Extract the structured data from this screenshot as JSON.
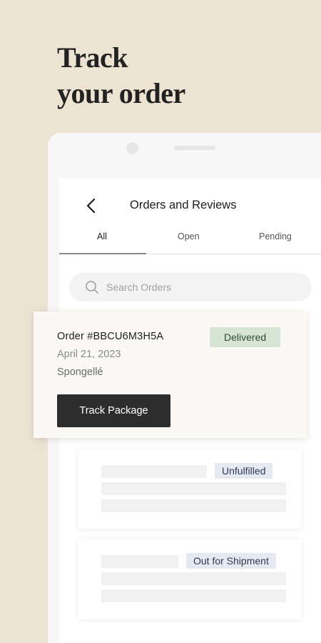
{
  "hero": {
    "line1": "Track",
    "line2": "your order"
  },
  "header": {
    "title": "Orders and Reviews",
    "back_icon": "chevron-left-icon"
  },
  "tabs": [
    {
      "label": "All",
      "active": true
    },
    {
      "label": "Open",
      "active": false
    },
    {
      "label": "Pending",
      "active": false
    }
  ],
  "search": {
    "placeholder": "Search Orders",
    "value": "",
    "icon": "search-icon"
  },
  "order": {
    "number": "Order #BBCU6M3H5A",
    "date": "April 21, 2023",
    "store": "Spongellé",
    "status": "Delivered",
    "track_label": "Track Package"
  },
  "other_orders": [
    {
      "status": "Unfulfilled"
    },
    {
      "status": "Out for Shipment"
    }
  ],
  "colors": {
    "background": "#ece3d3",
    "delivered_badge": "#d6e5d3",
    "status_badge": "#e5e9f1",
    "button": "#2d2d2d"
  }
}
